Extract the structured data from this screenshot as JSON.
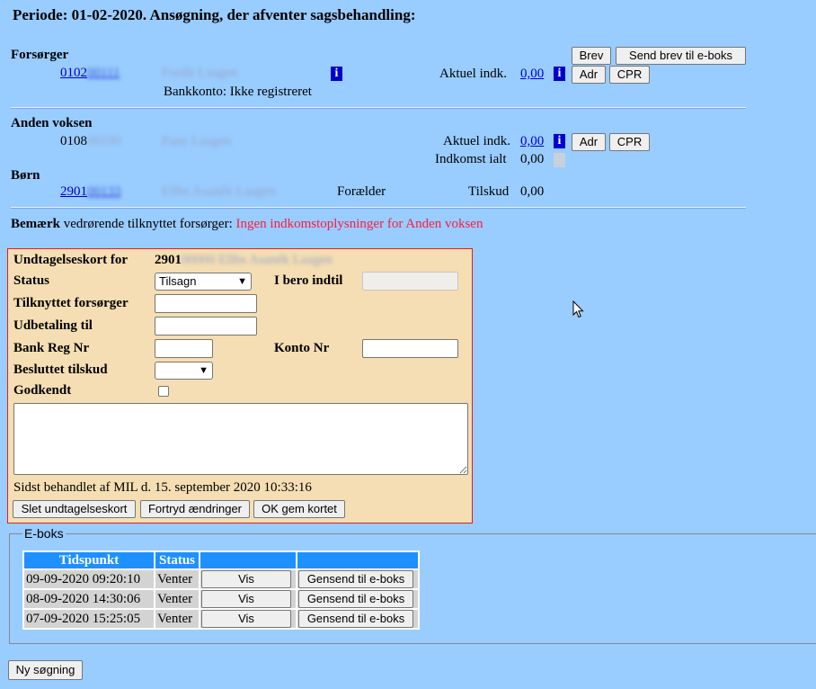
{
  "header": {
    "title": "Periode: 01-02-2020. Ansøgning, der afventer sagsbehandling:"
  },
  "forsorger": {
    "heading": "Forsørger",
    "cpr_visible": "0102",
    "cpr_hidden": "00111",
    "name_hidden": "Forälr Laagen",
    "info_icon_label": "i",
    "bank_label": "Bankkonto:",
    "bank_value": "Ikke registreret",
    "aktuel_label": "Aktuel indk.",
    "aktuel_value": "0,00",
    "buttons": {
      "brev": "Brev",
      "send_eboks": "Send brev til e-boks",
      "adr": "Adr",
      "cpr": "CPR"
    }
  },
  "anden_voksen": {
    "heading": "Anden voksen",
    "cpr_visible": "0108",
    "cpr_hidden": "00190",
    "name_hidden": "Pane Laagen",
    "aktuel_label": "Aktuel indk.",
    "aktuel_value": "0,00",
    "indkomst_label": "Indkomst ialt",
    "indkomst_value": "0,00",
    "buttons": {
      "adr": "Adr",
      "cpr": "CPR"
    }
  },
  "born": {
    "heading": "Børn",
    "cpr_visible": "2901",
    "cpr_hidden": "00133",
    "name_hidden": "Ellbs Asanék Laagen",
    "relation": "Forælder",
    "tilskud_label": "Tilskud",
    "tilskud_value": "0,00"
  },
  "bemaerk": {
    "label": "Bemærk",
    "text": "vedrørende tilknyttet forsørger:",
    "warning": "Ingen indkomstoplysninger for Anden voksen"
  },
  "form": {
    "card_label": "Undtagelseskort for",
    "card_cpr_visible": "2901",
    "card_hidden": "00000 Ellbs Asanék Laagen",
    "status_label": "Status",
    "status_value": "Tilsagn",
    "ibero_label": "I bero indtil",
    "tilknyttet_label": "Tilknyttet forsørger",
    "udbetaling_label": "Udbetaling til",
    "bankreg_label": "Bank Reg Nr",
    "konto_label": "Konto Nr",
    "besluttet_label": "Besluttet tilskud",
    "godkendt_label": "Godkendt",
    "last_handled": "Sidst behandlet af MIL d. 15. september 2020 10:33:16",
    "buttons": {
      "slet": "Slet undtagelseskort",
      "fortryd": "Fortryd ændringer",
      "ok": "OK gem kortet"
    }
  },
  "eboks": {
    "legend": "E-boks",
    "headers": [
      "Tidspunkt",
      "Status",
      "",
      ""
    ],
    "rows": [
      {
        "time": "09-09-2020 09:20:10",
        "status": "Venter",
        "vis": "Vis",
        "gensend": "Gensend til e-boks"
      },
      {
        "time": "08-09-2020 14:30:06",
        "status": "Venter",
        "vis": "Vis",
        "gensend": "Gensend til e-boks"
      },
      {
        "time": "07-09-2020 15:25:05",
        "status": "Venter",
        "vis": "Vis",
        "gensend": "Gensend til e-boks"
      }
    ]
  },
  "footer": {
    "ny_sogning": "Ny søgning"
  }
}
